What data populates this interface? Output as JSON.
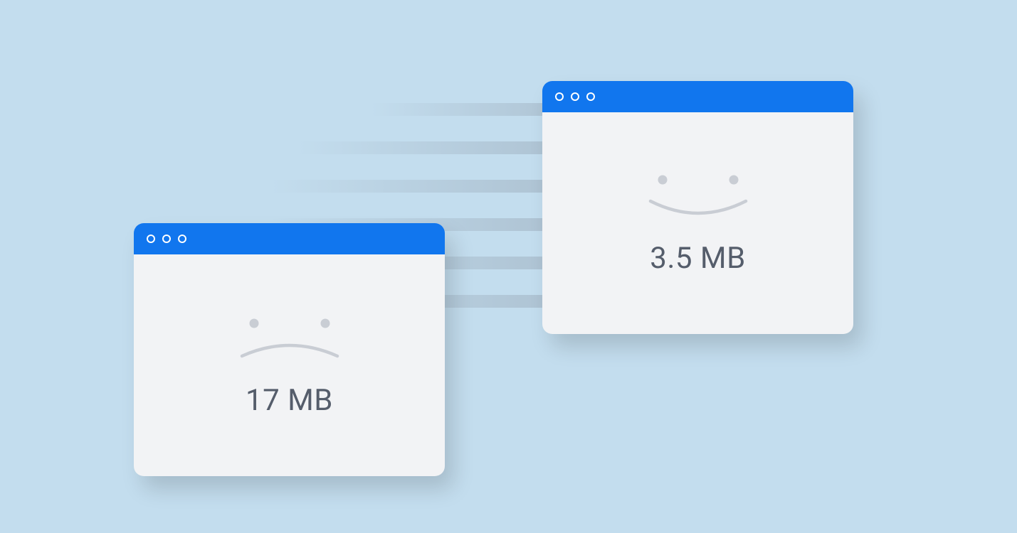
{
  "leftWindow": {
    "size": "17 MB"
  },
  "rightWindow": {
    "size": "3.5 MB"
  }
}
